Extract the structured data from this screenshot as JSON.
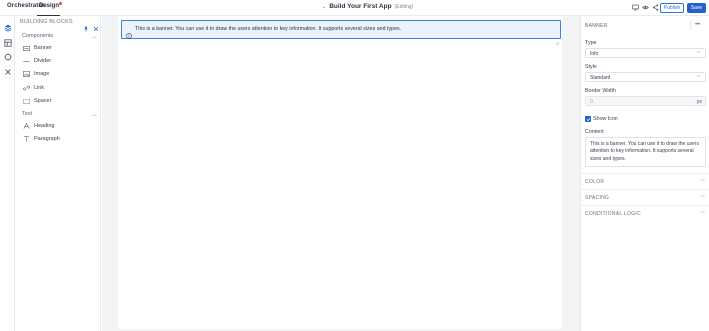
{
  "header": {
    "brand": "Orchestrator",
    "design_tab": "Design",
    "app_title": "Build Your First App",
    "app_badge": "(Editing)",
    "publish_label": "Publish",
    "save_label": "Save"
  },
  "rail": {
    "icons": [
      "blocks-icon",
      "pages-icon",
      "data-icon",
      "variables-icon"
    ]
  },
  "blocks_panel": {
    "title": "BUILDING BLOCKS",
    "sections": [
      {
        "label": "Components",
        "items": [
          {
            "label": "Banner",
            "icon": "banner-icon"
          },
          {
            "label": "Divider",
            "icon": "divider-icon"
          },
          {
            "label": "Image",
            "icon": "image-icon"
          },
          {
            "label": "Link",
            "icon": "link-icon"
          },
          {
            "label": "Spacer",
            "icon": "spacer-icon"
          }
        ]
      },
      {
        "label": "Text",
        "items": [
          {
            "label": "Heading",
            "icon": "heading-icon"
          },
          {
            "label": "Paragraph",
            "icon": "paragraph-icon"
          }
        ]
      }
    ]
  },
  "canvas": {
    "banner_text": "This is a banner. You can use it to draw the users attention to key information. It supports several sizes and types."
  },
  "properties": {
    "title": "BANNER",
    "type_label": "Type",
    "type_value": "Info",
    "style_label": "Style",
    "style_value": "Standard",
    "border_label": "Border Width",
    "border_value": "0",
    "border_unit": "px",
    "show_icon_label": "Show Icon",
    "content_label": "Content",
    "content_value": "This is a banner. You can use it to draw the users attention to key information. It supports several sizes and types.",
    "sections": [
      "COLOR",
      "SPACING",
      "CONDITIONAL LOGIC"
    ]
  },
  "colors": {
    "accent": "#2262c9",
    "banner_border": "#3b82dd",
    "banner_bg": "#eaf2fc"
  }
}
